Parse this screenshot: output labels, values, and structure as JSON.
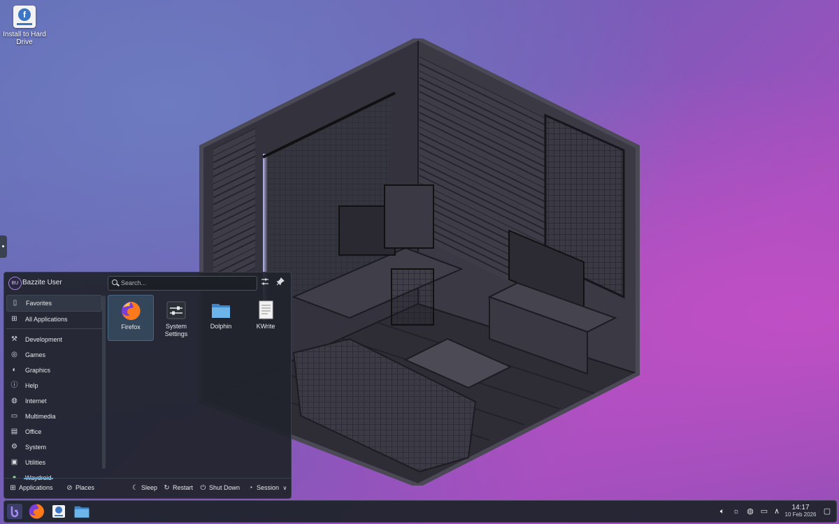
{
  "desktop": {
    "icon_label": "Install to Hard Drive"
  },
  "launcher": {
    "user_initials": "BU",
    "user_name": "Bazzite User",
    "search_placeholder": "Search...",
    "sidebar": {
      "items": [
        {
          "label": "Favorites",
          "icon": "bookmark-icon"
        },
        {
          "label": "All Applications",
          "icon": "grid-icon"
        },
        {
          "label": "Development",
          "icon": "wrench-icon"
        },
        {
          "label": "Games",
          "icon": "gamepad-icon"
        },
        {
          "label": "Graphics",
          "icon": "palette-icon"
        },
        {
          "label": "Help",
          "icon": "help-icon"
        },
        {
          "label": "Internet",
          "icon": "globe-icon"
        },
        {
          "label": "Multimedia",
          "icon": "monitor-icon"
        },
        {
          "label": "Office",
          "icon": "document-icon"
        },
        {
          "label": "System",
          "icon": "gear-icon"
        },
        {
          "label": "Utilities",
          "icon": "toolbox-icon"
        },
        {
          "label": "Waydroid",
          "icon": "android-icon"
        }
      ]
    },
    "apps": [
      {
        "label": "Firefox",
        "icon": "firefox-icon"
      },
      {
        "label": "System Settings",
        "icon": "system-settings-icon"
      },
      {
        "label": "Dolphin",
        "icon": "folder-icon"
      },
      {
        "label": "KWrite",
        "icon": "text-editor-icon"
      }
    ],
    "footer": {
      "applications": "Applications",
      "places": "Places",
      "sleep": "Sleep",
      "restart": "Restart",
      "shutdown": "Shut Down",
      "session": "Session"
    }
  },
  "taskbar": {
    "time": "14:17",
    "date": "10 Feb 2026"
  },
  "colors": {
    "accent": "#5ea8d8",
    "panel": "#20242c"
  }
}
